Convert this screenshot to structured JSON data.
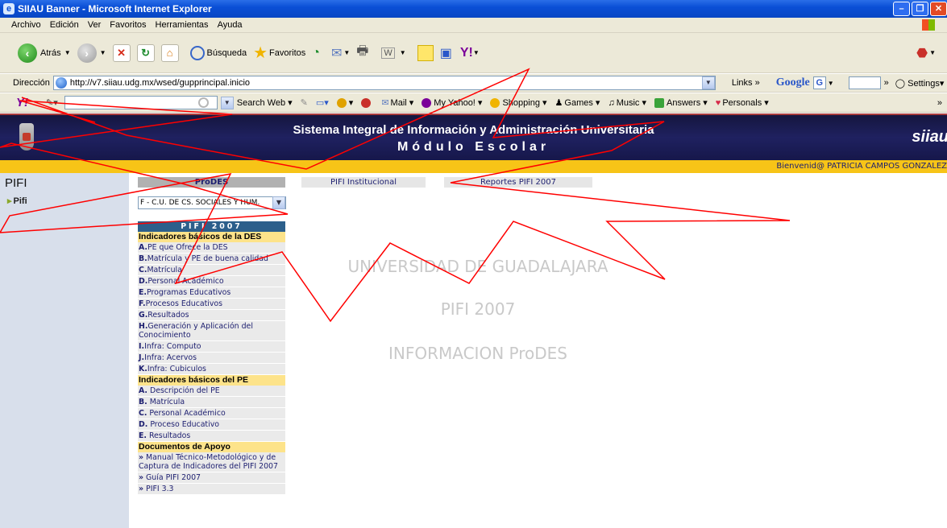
{
  "window": {
    "title": "SIIAU Banner - Microsoft Internet Explorer"
  },
  "menubar": {
    "items": [
      "Archivo",
      "Edición",
      "Ver",
      "Favoritos",
      "Herramientas",
      "Ayuda"
    ]
  },
  "toolbar": {
    "back": "Atrás",
    "search": "Búsqueda",
    "favorites": "Favoritos"
  },
  "address": {
    "label": "Dirección",
    "url": "http://v7.siiau.udg.mx/wsed/gupprincipal.inicio",
    "links": "Links",
    "google": "Google",
    "settings": "Settings"
  },
  "yahoo": {
    "search_web": "Search Web",
    "mail": "Mail",
    "my_yahoo": "My Yahoo!",
    "shopping": "Shopping",
    "games": "Games",
    "music": "Music",
    "answers": "Answers",
    "personals": "Personals"
  },
  "banner": {
    "title": "Sistema Integral de Información y Administración Universitaria",
    "subtitle": "Módulo Escolar",
    "logo": "siiau"
  },
  "greeting": "Bienvenid@ PATRICIA CAMPOS GONZALEZ",
  "sidebar": {
    "heading": "PIFI",
    "item": "Pifi"
  },
  "prodes": {
    "header": "ProDES",
    "selected": "F - C.U. DE CS. SOCIALES Y HUM."
  },
  "tabs": {
    "institucional": "PIFI Institucional",
    "reportes": "Reportes PIFI 2007"
  },
  "menu": {
    "title": "PIFI 2007",
    "sections": [
      {
        "heading": "Indicadores básicos de la DES",
        "items": [
          {
            "letter": "A.",
            "text": "PE que Ofrece la DES"
          },
          {
            "letter": "B.",
            "text": "Matrícula y PE de buena calidad"
          },
          {
            "letter": "C.",
            "text": "Matrícula"
          },
          {
            "letter": "D.",
            "text": "Personal Académico"
          },
          {
            "letter": "E.",
            "text": "Programas Educativos"
          },
          {
            "letter": "F.",
            "text": "Procesos Educativos"
          },
          {
            "letter": "G.",
            "text": "Resultados"
          },
          {
            "letter": "H.",
            "text": "Generación y Aplicación del Conocimiento"
          },
          {
            "letter": "I.",
            "text": "Infra: Computo"
          },
          {
            "letter": "J.",
            "text": "Infra: Acervos"
          },
          {
            "letter": "K.",
            "text": "Infra: Cubiculos"
          }
        ]
      },
      {
        "heading": "Indicadores básicos del PE",
        "items": [
          {
            "letter": "A.",
            "text": " Descripción del PE"
          },
          {
            "letter": "B.",
            "text": " Matrícula"
          },
          {
            "letter": "C.",
            "text": " Personal Académico"
          },
          {
            "letter": "D.",
            "text": " Proceso Educativo"
          },
          {
            "letter": "E.",
            "text": " Resultados"
          }
        ]
      },
      {
        "heading": "Documentos de Apoyo",
        "items": [
          {
            "letter": "»",
            "text": " Manual Técnico-Metodológico y de Captura de Indicadores del PIFI 2007"
          },
          {
            "letter": "»",
            "text": " Guía PIFI 2007"
          },
          {
            "letter": "»",
            "text": " PIFI 3.3"
          }
        ]
      }
    ]
  },
  "watermark": {
    "line1": "UNIVERSIDAD DE GUADALAJARA",
    "line2": "PIFI 2007",
    "line3": "INFORMACION ProDES"
  },
  "colors": {
    "banner": "#1f2160",
    "yellow_bar": "#f7c417",
    "menu_title": "#2c5f8b",
    "section": "#fde38a",
    "annotation": "#ff0000"
  }
}
